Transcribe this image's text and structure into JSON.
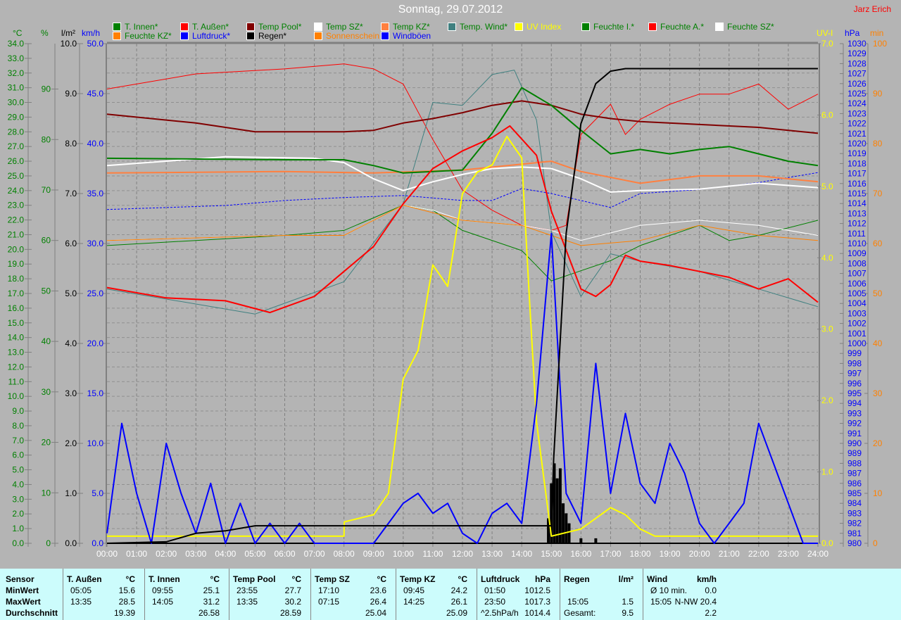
{
  "header": {
    "title": "Sonntag, 29.07.2012",
    "author": "Jarz Erich"
  },
  "units": {
    "celsius": "°C",
    "percent": "%",
    "rain": "l/m²",
    "wind": "km/h",
    "uv": "UV-I",
    "pressure": "hPa",
    "minutes": "min"
  },
  "legend": [
    {
      "label": "T. Innen*",
      "color": "#008000",
      "text_color": "#008000"
    },
    {
      "label": "T. Außen*",
      "color": "#ff0000",
      "text_color": "#008000"
    },
    {
      "label": "Temp Pool*",
      "color": "#800000",
      "text_color": "#008000"
    },
    {
      "label": "Temp SZ*",
      "color": "#ffffff",
      "text_color": "#008000"
    },
    {
      "label": "Temp KZ*",
      "color": "#ff8040",
      "text_color": "#008000"
    },
    {
      "label": "Temp. Wind*",
      "color": "#408080",
      "text_color": "#008000"
    },
    {
      "label": "UV Index",
      "color": "#ffff00",
      "text_color": "#ffff00"
    },
    {
      "label": "Feuchte I.*",
      "color": "#008000",
      "text_color": "#008000"
    },
    {
      "label": "Feuchte A.*",
      "color": "#ff0000",
      "text_color": "#008000"
    },
    {
      "label": "Feuchte SZ*",
      "color": "#ffffff",
      "text_color": "#008000"
    },
    {
      "label": "Feuchte KZ*",
      "color": "#ff8000",
      "text_color": "#008000"
    },
    {
      "label": "Luftdruck*",
      "color": "#0000ff",
      "text_color": "#0000ff"
    },
    {
      "label": "Regen*",
      "color": "#000000",
      "text_color": "#000000"
    },
    {
      "label": "Sonnenschein",
      "color": "#ff8000",
      "text_color": "#ff8000"
    },
    {
      "label": "Windböen",
      "color": "#0000ff",
      "text_color": "#0000ff"
    }
  ],
  "chart_data": {
    "type": "line",
    "title": "Sonntag, 29.07.2012",
    "grid": true,
    "x_ticks": [
      "00:00",
      "01:00",
      "02:00",
      "03:00",
      "04:00",
      "05:00",
      "06:00",
      "07:00",
      "08:00",
      "09:00",
      "10:00",
      "11:00",
      "12:00",
      "13:00",
      "14:00",
      "15:00",
      "16:00",
      "17:00",
      "18:00",
      "19:00",
      "20:00",
      "21:00",
      "22:00",
      "23:00",
      "24:00"
    ],
    "xlim": [
      0,
      24
    ],
    "axes": {
      "celsius": {
        "min": 0,
        "max": 34,
        "step": 1,
        "decimals": 1,
        "color": "#008000"
      },
      "percent": {
        "min": 0,
        "max": 99,
        "step": 10,
        "decimals": 0,
        "color": "#008000",
        "label_max": 90
      },
      "rain": {
        "min": 0,
        "max": 10,
        "step": 1,
        "decimals": 1,
        "color": "#000000"
      },
      "wind": {
        "min": 0,
        "max": 50,
        "step": 5,
        "decimals": 1,
        "color": "#0000ff"
      },
      "uv": {
        "min": 0,
        "max": 7,
        "step": 1,
        "decimals": 1,
        "color": "#ffff00"
      },
      "pressure": {
        "min": 980,
        "max": 1030,
        "step": 1,
        "decimals": 0,
        "color": "#0000ff"
      },
      "minutes": {
        "min": 0,
        "max": 100,
        "step": 10,
        "decimals": 0,
        "color": "#ff8000"
      }
    },
    "series": [
      {
        "name": "Feuchte A.",
        "axis": "percent",
        "color": "#ff0000",
        "width": 1,
        "x": [
          0,
          3,
          6,
          8,
          9,
          10,
          11,
          12,
          13,
          14,
          15,
          15.5,
          16,
          17,
          17.5,
          18,
          19,
          20,
          21,
          22,
          23,
          24
        ],
        "y": [
          90,
          93,
          94,
          95,
          94,
          91,
          80,
          70,
          66,
          63,
          62,
          63,
          81,
          87,
          81,
          84,
          87,
          89,
          89,
          91,
          86,
          89
        ]
      },
      {
        "name": "Feuchte I.",
        "axis": "percent",
        "color": "#008000",
        "width": 1,
        "x": [
          0,
          6,
          8,
          10,
          11,
          12,
          14,
          15,
          16,
          17,
          18,
          20,
          21,
          22,
          24
        ],
        "y": [
          59,
          61,
          62,
          67,
          66,
          62,
          58,
          52,
          54,
          56,
          59,
          63,
          60,
          61,
          64
        ]
      },
      {
        "name": "Feuchte SZ",
        "axis": "percent",
        "color": "#ffffff",
        "width": 1,
        "x": [
          0,
          6,
          8,
          10,
          11,
          12,
          14,
          15,
          16,
          18,
          20,
          22,
          24
        ],
        "y": [
          60,
          61,
          61,
          67,
          66,
          64,
          63,
          62,
          60,
          63,
          64,
          63,
          61
        ]
      },
      {
        "name": "Feuchte KZ",
        "axis": "percent",
        "color": "#ff8000",
        "width": 1,
        "x": [
          0,
          6,
          8,
          10,
          12,
          14,
          16,
          18,
          20,
          22,
          24
        ],
        "y": [
          60,
          61,
          61,
          67,
          64,
          63,
          59,
          60,
          63,
          61,
          60
        ]
      },
      {
        "name": "Luftdruck",
        "axis": "pressure",
        "color": "#0000ff",
        "width": 1,
        "dash": "3,2",
        "x": [
          0,
          2,
          4,
          6,
          8,
          10,
          12,
          13,
          14,
          15,
          16,
          17,
          18,
          20,
          22,
          24
        ],
        "y": [
          1013.4,
          1013.6,
          1013.8,
          1014.3,
          1014.6,
          1014.8,
          1014.3,
          1014.3,
          1015.5,
          1015.0,
          1014.3,
          1013.6,
          1015.0,
          1015.4,
          1016.1,
          1017.1
        ]
      },
      {
        "name": "Temp. Wind",
        "axis": "celsius",
        "color": "#408080",
        "width": 1,
        "x": [
          0,
          5,
          8,
          10,
          11,
          12,
          13,
          13.75,
          14.5,
          15,
          16,
          17,
          18,
          20,
          22,
          24
        ],
        "y": [
          17.3,
          15.6,
          17.8,
          23.1,
          30.0,
          29.8,
          31.9,
          32.2,
          28.8,
          21.2,
          16.8,
          19.7,
          19.2,
          18.5,
          17.3,
          16.1
        ]
      },
      {
        "name": "Temp KZ",
        "axis": "celsius",
        "color": "#ff8040",
        "width": 2,
        "x": [
          0,
          6,
          9,
          12,
          14,
          15,
          16,
          18,
          20,
          22,
          24
        ],
        "y": [
          25.2,
          25.3,
          25.2,
          25.4,
          25.8,
          26.0,
          25.3,
          24.5,
          25.0,
          25.0,
          24.6
        ]
      },
      {
        "name": "Temp SZ",
        "axis": "celsius",
        "color": "#ffffff",
        "width": 2,
        "x": [
          0,
          4,
          7,
          8,
          9,
          10,
          11,
          12,
          13,
          14,
          15,
          16,
          17,
          18,
          20,
          22,
          24
        ],
        "y": [
          25.7,
          26.3,
          26.2,
          25.9,
          24.8,
          24.0,
          24.6,
          25.1,
          25.5,
          25.6,
          25.5,
          24.8,
          23.9,
          24.0,
          24.1,
          24.5,
          24.2
        ]
      },
      {
        "name": "Temp Pool",
        "axis": "celsius",
        "color": "#800000",
        "width": 2,
        "x": [
          0,
          3,
          5,
          8,
          9,
          10,
          11,
          12,
          13,
          14,
          15,
          16,
          17,
          18,
          20,
          22,
          24
        ],
        "y": [
          29.2,
          28.6,
          28.0,
          28.0,
          28.1,
          28.6,
          28.9,
          29.3,
          29.8,
          30.1,
          29.8,
          29.2,
          28.9,
          28.7,
          28.5,
          28.3,
          27.9
        ]
      },
      {
        "name": "T. Innen",
        "axis": "celsius",
        "color": "#008000",
        "width": 2,
        "x": [
          0,
          6,
          8,
          9,
          10,
          11,
          12,
          13,
          14,
          15,
          16,
          17,
          18,
          19,
          20,
          21,
          22,
          23,
          24
        ],
        "y": [
          26.2,
          26.1,
          26.1,
          25.7,
          25.2,
          25.3,
          25.4,
          27.9,
          31.0,
          29.8,
          28.1,
          26.5,
          26.8,
          26.5,
          26.8,
          27.0,
          26.5,
          26.0,
          25.7
        ]
      },
      {
        "name": "T. Außen",
        "axis": "celsius",
        "color": "#ff0000",
        "width": 2,
        "x": [
          0,
          2,
          4,
          5.5,
          7,
          8,
          9,
          10,
          11,
          12,
          13,
          13.6,
          14.5,
          15,
          16,
          16.5,
          17,
          17.5,
          18,
          19,
          20,
          21,
          22,
          23,
          24
        ],
        "y": [
          17.4,
          16.7,
          16.5,
          15.7,
          16.8,
          18.5,
          20.2,
          23.1,
          25.5,
          26.7,
          27.6,
          28.4,
          26.4,
          22.6,
          17.3,
          16.8,
          17.6,
          19.6,
          19.2,
          18.9,
          18.5,
          18.1,
          17.3,
          18.0,
          16.4
        ]
      },
      {
        "name": "UV Index",
        "axis": "uv",
        "color": "#ffff00",
        "width": 2,
        "x": [
          0,
          8,
          8.01,
          9,
          9.5,
          10,
          10.5,
          11,
          11.5,
          12,
          12.5,
          13,
          13.5,
          14,
          14.25,
          14.5,
          15,
          16,
          17,
          17.5,
          18,
          18.5,
          24
        ],
        "y": [
          0.1,
          0.1,
          0.3,
          0.4,
          0.7,
          2.3,
          2.7,
          3.9,
          3.6,
          4.9,
          5.2,
          5.3,
          5.7,
          5.4,
          3.5,
          1.7,
          0.1,
          0.2,
          0.5,
          0.4,
          0.2,
          0.1,
          0.1
        ]
      },
      {
        "name": "Windböen",
        "axis": "wind",
        "color": "#0000ff",
        "width": 2,
        "x": [
          0,
          0.5,
          1,
          1.5,
          2,
          2.5,
          3,
          3.5,
          4,
          4.5,
          5,
          5.5,
          6,
          6.5,
          7,
          7.5,
          8,
          8.5,
          9,
          9.5,
          10,
          10.5,
          11,
          11.5,
          12,
          12.5,
          13,
          13.5,
          14,
          14.5,
          15,
          15.5,
          16,
          16.5,
          17,
          17.5,
          18,
          18.5,
          19,
          19.5,
          20,
          20.5,
          21,
          21.5,
          22,
          22.5,
          23,
          23.5,
          24
        ],
        "y": [
          1,
          12,
          5,
          0,
          10,
          5,
          1,
          6,
          0,
          4,
          0,
          2,
          0,
          2,
          0,
          0,
          0,
          0,
          0,
          2,
          4,
          5,
          3,
          4,
          1,
          0,
          3,
          4,
          2,
          14,
          31,
          5,
          2,
          18,
          5,
          13,
          6,
          4,
          10,
          7,
          2,
          0,
          2,
          4,
          12,
          8,
          4,
          0,
          0
        ]
      },
      {
        "name": "Regen",
        "axis": "rain",
        "color": "#000000",
        "width": 2,
        "x": [
          0,
          2,
          3,
          4,
          5,
          15,
          15.08,
          15.5,
          16,
          16.5,
          17,
          17.5,
          24
        ],
        "y": [
          0,
          0.03,
          0.2,
          0.25,
          0.35,
          0.35,
          1.7,
          6.2,
          8.4,
          9.2,
          9.45,
          9.5,
          9.5
        ]
      }
    ],
    "rain_bars": {
      "axis": "rain",
      "x": [
        14.9,
        15.0,
        15.1,
        15.2,
        15.3,
        15.4,
        15.5,
        15.6,
        16.0,
        16.5
      ],
      "y": [
        0.5,
        1.2,
        1.6,
        1.3,
        1.5,
        0.8,
        0.6,
        0.4,
        0.1,
        0.1
      ]
    }
  },
  "table": {
    "row_labels": [
      "Sensor",
      "MinWert",
      "MaxWert",
      "Durchschnitt"
    ],
    "groups": [
      {
        "name": "T. Außen",
        "unit": "°C",
        "min_time": "05:05",
        "min": "15.6",
        "max_time": "13:35",
        "max": "28.5",
        "avg_label": "",
        "avg": "19.39"
      },
      {
        "name": "T. Innen",
        "unit": "°C",
        "min_time": "09:55",
        "min": "25.1",
        "max_time": "14:05",
        "max": "31.2",
        "avg_label": "",
        "avg": "26.58"
      },
      {
        "name": "Temp Pool",
        "unit": "°C",
        "min_time": "23:55",
        "min": "27.7",
        "max_time": "13:35",
        "max": "30.2",
        "avg_label": "",
        "avg": "28.59"
      },
      {
        "name": "Temp SZ",
        "unit": "°C",
        "min_time": "17:10",
        "min": "23.6",
        "max_time": "07:15",
        "max": "26.4",
        "avg_label": "",
        "avg": "25.04"
      },
      {
        "name": "Temp KZ",
        "unit": "°C",
        "min_time": "09:45",
        "min": "24.2",
        "max_time": "14:25",
        "max": "26.1",
        "avg_label": "",
        "avg": "25.09"
      },
      {
        "name": "Luftdruck",
        "unit": "hPa",
        "min_time": "01:50",
        "min": "1012.5",
        "max_time": "23:50",
        "max": "1017.3",
        "avg_label": "^2.5hPa/h",
        "avg": "1014.4"
      },
      {
        "name": "Regen",
        "unit": "l/m²",
        "min_time": "",
        "min": "",
        "max_time": "15:05",
        "max": "1.5",
        "avg_label": "Gesamt:",
        "avg": "9.5"
      },
      {
        "name": "Wind",
        "unit": "km/h",
        "min_time": "Ø 10 min.",
        "min": "0.0",
        "max_time": "15:05",
        "max": "N-NW 20.4",
        "avg_label": "",
        "avg": "2.2"
      }
    ]
  }
}
